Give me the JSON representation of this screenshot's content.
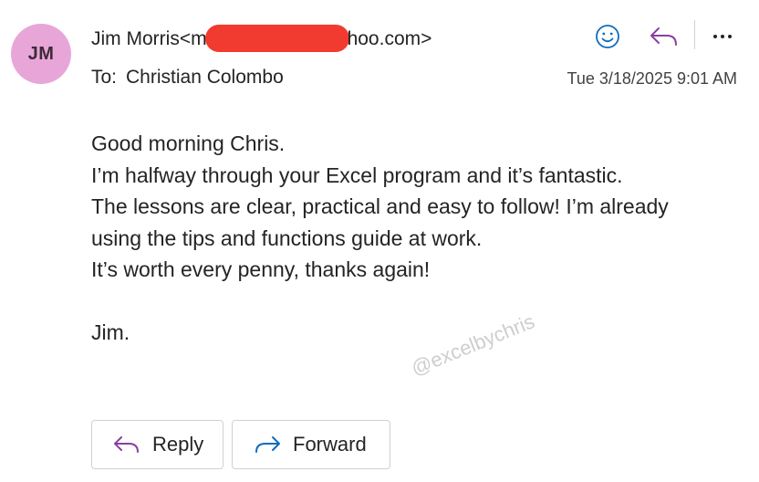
{
  "sender": {
    "initials": "JM",
    "name_prefix": "Jim Morris<m",
    "name_suffix": "hoo.com>",
    "avatar_color": "#e8a6d8",
    "redaction_color": "#f23b30"
  },
  "recipient": {
    "label": "To:",
    "name": "Christian Colombo"
  },
  "date": "Tue 3/18/2025 9:01 AM",
  "header_actions": {
    "emoji_icon": "smiley-icon",
    "reply_icon": "reply-arrow-icon",
    "more_label": "···"
  },
  "body": {
    "lines": [
      "Good morning Chris.",
      "I’m halfway through your Excel program and it’s fantastic.",
      "The lessons are clear, practical and easy to follow! I’m already",
      "using the tips and functions guide at work.",
      "It’s worth every penny, thanks again!"
    ],
    "signature": "Jim."
  },
  "watermark": "@excelbychris",
  "buttons": {
    "reply_label": "Reply",
    "forward_label": "Forward"
  },
  "colors": {
    "accent_blue": "#0f6cbd",
    "accent_purple": "#8a3fa0"
  }
}
